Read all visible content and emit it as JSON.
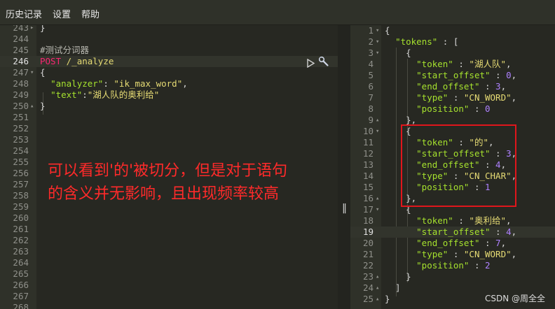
{
  "menu": {
    "items": [
      "历史记录",
      "设置",
      "帮助"
    ]
  },
  "left_editor": {
    "lines": [
      {
        "n": "243",
        "fold": "▸",
        "code": [
          {
            "t": "}",
            "c": "pun"
          }
        ]
      },
      {
        "n": "244",
        "fold": "",
        "code": []
      },
      {
        "n": "245",
        "fold": "",
        "code": [
          {
            "t": "#测试分词器",
            "c": "cmt"
          }
        ]
      },
      {
        "n": "246",
        "fold": "",
        "code": [
          {
            "t": "POST ",
            "c": "mth"
          },
          {
            "t": "/_analyze",
            "c": "url"
          }
        ],
        "highlight": true
      },
      {
        "n": "247",
        "fold": "▾",
        "code": [
          {
            "t": "{",
            "c": "pun"
          }
        ]
      },
      {
        "n": "248",
        "fold": "",
        "code": [
          {
            "t": "  ",
            "c": "pun"
          },
          {
            "t": "\"analyzer\"",
            "c": "key"
          },
          {
            "t": ": ",
            "c": "pun"
          },
          {
            "t": "\"ik_max_word\"",
            "c": "str"
          },
          {
            "t": ",",
            "c": "pun"
          }
        ]
      },
      {
        "n": "249",
        "fold": "",
        "code": [
          {
            "t": "  ",
            "c": "pun"
          },
          {
            "t": "\"text\"",
            "c": "key"
          },
          {
            "t": ":",
            "c": "pun"
          },
          {
            "t": "\"湖人队的奥利给\"",
            "c": "str"
          }
        ]
      },
      {
        "n": "250",
        "fold": "▴",
        "code": [
          {
            "t": "}",
            "c": "pun"
          }
        ]
      },
      {
        "n": "251",
        "fold": "",
        "code": []
      },
      {
        "n": "252",
        "fold": "",
        "code": []
      },
      {
        "n": "253",
        "fold": "",
        "code": []
      },
      {
        "n": "254",
        "fold": "",
        "code": []
      },
      {
        "n": "255",
        "fold": "",
        "code": []
      },
      {
        "n": "256",
        "fold": "",
        "code": []
      },
      {
        "n": "257",
        "fold": "",
        "code": []
      },
      {
        "n": "258",
        "fold": "",
        "code": []
      },
      {
        "n": "259",
        "fold": "",
        "code": []
      },
      {
        "n": "260",
        "fold": "",
        "code": []
      },
      {
        "n": "261",
        "fold": "",
        "code": []
      },
      {
        "n": "262",
        "fold": "",
        "code": []
      },
      {
        "n": "263",
        "fold": "",
        "code": []
      },
      {
        "n": "264",
        "fold": "",
        "code": []
      },
      {
        "n": "265",
        "fold": "",
        "code": []
      },
      {
        "n": "266",
        "fold": "",
        "code": []
      },
      {
        "n": "267",
        "fold": "",
        "code": []
      },
      {
        "n": "268",
        "fold": "",
        "code": []
      }
    ]
  },
  "right_editor": {
    "lines": [
      {
        "n": "1",
        "fold": "▾",
        "code": [
          {
            "t": "{",
            "c": "pun"
          }
        ]
      },
      {
        "n": "2",
        "fold": "▾",
        "code": [
          {
            "t": "  ",
            "c": "pun"
          },
          {
            "t": "\"tokens\"",
            "c": "key"
          },
          {
            "t": " : [",
            "c": "pun"
          }
        ]
      },
      {
        "n": "3",
        "fold": "▾",
        "code": [
          {
            "t": "    {",
            "c": "pun"
          }
        ]
      },
      {
        "n": "4",
        "fold": "",
        "code": [
          {
            "t": "      ",
            "c": "pun"
          },
          {
            "t": "\"token\"",
            "c": "key"
          },
          {
            "t": " : ",
            "c": "pun"
          },
          {
            "t": "\"湖人队\"",
            "c": "str"
          },
          {
            "t": ",",
            "c": "pun"
          }
        ]
      },
      {
        "n": "5",
        "fold": "",
        "code": [
          {
            "t": "      ",
            "c": "pun"
          },
          {
            "t": "\"start_offset\"",
            "c": "key"
          },
          {
            "t": " : ",
            "c": "pun"
          },
          {
            "t": "0",
            "c": "num"
          },
          {
            "t": ",",
            "c": "pun"
          }
        ]
      },
      {
        "n": "6",
        "fold": "",
        "code": [
          {
            "t": "      ",
            "c": "pun"
          },
          {
            "t": "\"end_offset\"",
            "c": "key"
          },
          {
            "t": " : ",
            "c": "pun"
          },
          {
            "t": "3",
            "c": "num"
          },
          {
            "t": ",",
            "c": "pun"
          }
        ]
      },
      {
        "n": "7",
        "fold": "",
        "code": [
          {
            "t": "      ",
            "c": "pun"
          },
          {
            "t": "\"type\"",
            "c": "key"
          },
          {
            "t": " : ",
            "c": "pun"
          },
          {
            "t": "\"CN_WORD\"",
            "c": "str"
          },
          {
            "t": ",",
            "c": "pun"
          }
        ]
      },
      {
        "n": "8",
        "fold": "",
        "code": [
          {
            "t": "      ",
            "c": "pun"
          },
          {
            "t": "\"position\"",
            "c": "key"
          },
          {
            "t": " : ",
            "c": "pun"
          },
          {
            "t": "0",
            "c": "num"
          }
        ]
      },
      {
        "n": "9",
        "fold": "▴",
        "code": [
          {
            "t": "    },",
            "c": "pun"
          }
        ]
      },
      {
        "n": "10",
        "fold": "▾",
        "code": [
          {
            "t": "    {",
            "c": "pun"
          }
        ]
      },
      {
        "n": "11",
        "fold": "",
        "code": [
          {
            "t": "      ",
            "c": "pun"
          },
          {
            "t": "\"token\"",
            "c": "key"
          },
          {
            "t": " : ",
            "c": "pun"
          },
          {
            "t": "\"的\"",
            "c": "str"
          },
          {
            "t": ",",
            "c": "pun"
          }
        ]
      },
      {
        "n": "12",
        "fold": "",
        "code": [
          {
            "t": "      ",
            "c": "pun"
          },
          {
            "t": "\"start_offset\"",
            "c": "key"
          },
          {
            "t": " : ",
            "c": "pun"
          },
          {
            "t": "3",
            "c": "num"
          },
          {
            "t": ",",
            "c": "pun"
          }
        ]
      },
      {
        "n": "13",
        "fold": "",
        "code": [
          {
            "t": "      ",
            "c": "pun"
          },
          {
            "t": "\"end_offset\"",
            "c": "key"
          },
          {
            "t": " : ",
            "c": "pun"
          },
          {
            "t": "4",
            "c": "num"
          },
          {
            "t": ",",
            "c": "pun"
          }
        ]
      },
      {
        "n": "14",
        "fold": "",
        "code": [
          {
            "t": "      ",
            "c": "pun"
          },
          {
            "t": "\"type\"",
            "c": "key"
          },
          {
            "t": " : ",
            "c": "pun"
          },
          {
            "t": "\"CN_CHAR\"",
            "c": "str"
          },
          {
            "t": ",",
            "c": "pun"
          }
        ]
      },
      {
        "n": "15",
        "fold": "",
        "code": [
          {
            "t": "      ",
            "c": "pun"
          },
          {
            "t": "\"position\"",
            "c": "key"
          },
          {
            "t": " : ",
            "c": "pun"
          },
          {
            "t": "1",
            "c": "num"
          }
        ]
      },
      {
        "n": "16",
        "fold": "▴",
        "code": [
          {
            "t": "    },",
            "c": "pun"
          }
        ]
      },
      {
        "n": "17",
        "fold": "▾",
        "code": [
          {
            "t": "    {",
            "c": "pun"
          }
        ]
      },
      {
        "n": "18",
        "fold": "",
        "code": [
          {
            "t": "      ",
            "c": "pun"
          },
          {
            "t": "\"token\"",
            "c": "key"
          },
          {
            "t": " : ",
            "c": "pun"
          },
          {
            "t": "\"奥利给\"",
            "c": "str"
          },
          {
            "t": ",",
            "c": "pun"
          }
        ]
      },
      {
        "n": "19",
        "fold": "",
        "code": [
          {
            "t": "      ",
            "c": "pun"
          },
          {
            "t": "\"start_offset\"",
            "c": "key"
          },
          {
            "t": " : ",
            "c": "pun"
          },
          {
            "t": "4",
            "c": "num"
          },
          {
            "t": ",",
            "c": "pun"
          }
        ],
        "highlight": true
      },
      {
        "n": "20",
        "fold": "",
        "code": [
          {
            "t": "      ",
            "c": "pun"
          },
          {
            "t": "\"end_offset\"",
            "c": "key"
          },
          {
            "t": " : ",
            "c": "pun"
          },
          {
            "t": "7",
            "c": "num"
          },
          {
            "t": ",",
            "c": "pun"
          }
        ]
      },
      {
        "n": "21",
        "fold": "",
        "code": [
          {
            "t": "      ",
            "c": "pun"
          },
          {
            "t": "\"type\"",
            "c": "key"
          },
          {
            "t": " : ",
            "c": "pun"
          },
          {
            "t": "\"CN_WORD\"",
            "c": "str"
          },
          {
            "t": ",",
            "c": "pun"
          }
        ]
      },
      {
        "n": "22",
        "fold": "",
        "code": [
          {
            "t": "      ",
            "c": "pun"
          },
          {
            "t": "\"position\"",
            "c": "key"
          },
          {
            "t": " : ",
            "c": "pun"
          },
          {
            "t": "2",
            "c": "num"
          }
        ]
      },
      {
        "n": "23",
        "fold": "▴",
        "code": [
          {
            "t": "    }",
            "c": "pun"
          }
        ]
      },
      {
        "n": "24",
        "fold": "▴",
        "code": [
          {
            "t": "  ]",
            "c": "pun"
          }
        ]
      },
      {
        "n": "25",
        "fold": "▴",
        "code": [
          {
            "t": "}",
            "c": "pun"
          }
        ]
      }
    ]
  },
  "annotation": {
    "line1": "可以看到'的'被切分，但是对于语句",
    "line2": "的含义并无影响，且出现频率较高"
  },
  "toolbar": {
    "play_icon": "play-icon",
    "wrench_icon": "wrench-icon",
    "divider_handle": "‖"
  },
  "watermark": "CSDN @周全全",
  "colors": {
    "background": "#272822",
    "key": "#a6e22e",
    "string": "#e6db74",
    "number": "#ae81ff",
    "method": "#f92672",
    "annotation": "#ff2a2a",
    "box": "#e0161c"
  }
}
